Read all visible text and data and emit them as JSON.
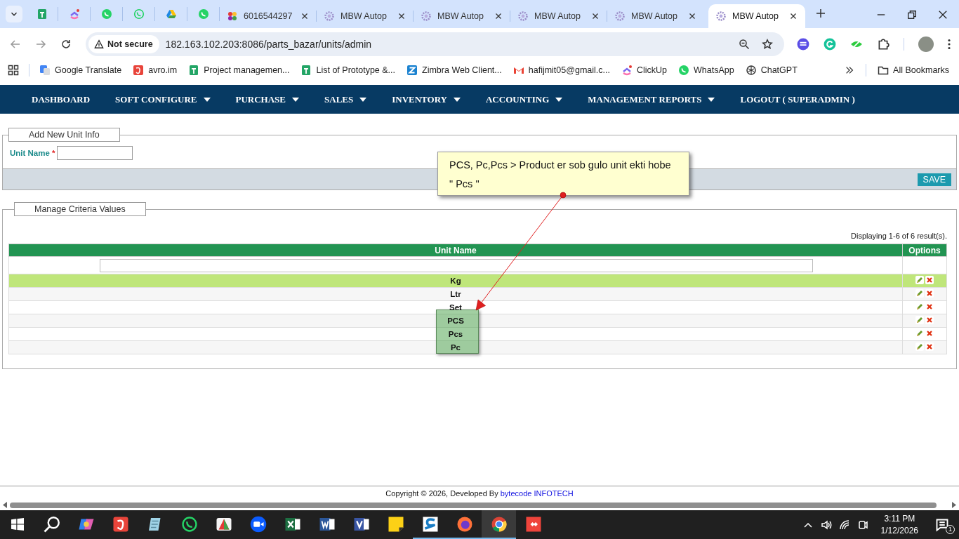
{
  "browser": {
    "tabs": [
      {
        "kind": "sheet",
        "selected": false
      },
      {
        "kind": "clickup",
        "selected": false
      },
      {
        "kind": "chat",
        "selected": false
      },
      {
        "kind": "chat-outline",
        "selected": false
      },
      {
        "kind": "drive",
        "selected": false
      },
      {
        "kind": "chat",
        "selected": false
      },
      {
        "kind": "pinwheel",
        "title": "6016544297",
        "selected": false
      },
      {
        "kind": "flower",
        "title": "MBW Autop",
        "selected": false
      },
      {
        "kind": "flower",
        "title": "MBW Autop",
        "selected": false
      },
      {
        "kind": "flower",
        "title": "MBW Autop",
        "selected": false
      },
      {
        "kind": "flower",
        "title": "MBW Autop",
        "selected": false
      },
      {
        "kind": "flower",
        "title": "MBW Autop",
        "selected": true
      }
    ],
    "security_label": "Not secure",
    "url": "182.163.102.203:8086/parts_bazar/units/admin",
    "bookmarks": [
      {
        "kind": "translate",
        "label": "Google Translate"
      },
      {
        "kind": "avro",
        "label": "avro.im"
      },
      {
        "kind": "sheet",
        "label": "Project managemen..."
      },
      {
        "kind": "sheet",
        "label": "List of Prototype &..."
      },
      {
        "kind": "zimbra",
        "label": "Zimbra Web Client..."
      },
      {
        "kind": "mail",
        "label": "hafijmit05@gmail.c..."
      },
      {
        "kind": "clickup",
        "label": "ClickUp"
      },
      {
        "kind": "chat",
        "label": "WhatsApp"
      },
      {
        "kind": "knot",
        "label": "ChatGPT"
      }
    ],
    "all_bookmarks": "All Bookmarks"
  },
  "nav": [
    {
      "label": "DASHBOARD",
      "has_menu": false
    },
    {
      "label": "SOFT CONFIGURE",
      "has_menu": true
    },
    {
      "label": "PURCHASE",
      "has_menu": true
    },
    {
      "label": "SALES",
      "has_menu": true
    },
    {
      "label": "INVENTORY",
      "has_menu": true
    },
    {
      "label": "ACCOUNTING",
      "has_menu": true
    },
    {
      "label": "MANAGEMENT REPORTS",
      "has_menu": true
    },
    {
      "label": "LOGOUT ( SUPERADMIN )",
      "has_menu": false
    }
  ],
  "unit_form": {
    "legend": "Add New Unit Info",
    "field_label": "Unit Name",
    "required_mark": "*",
    "save_button": "SAVE"
  },
  "criteria": {
    "legend": "Manage Criteria Values",
    "summary": "Displaying 1-6 of 6 result(s).",
    "columns": [
      "Unit Name",
      "Options"
    ],
    "rows": [
      {
        "name": "Kg",
        "selected": true
      },
      {
        "name": "Ltr",
        "selected": false
      },
      {
        "name": "Set",
        "selected": false
      },
      {
        "name": "PCS",
        "selected": false
      },
      {
        "name": "Pcs",
        "selected": false
      },
      {
        "name": "Pc",
        "selected": false
      }
    ]
  },
  "annotation": {
    "lines": [
      "PCS, Pc,Pcs > Product er sob gulo unit ekti hobe",
      "\" Pcs \""
    ]
  },
  "footer": {
    "text": "Copyright © 2026, Developed By",
    "link": "bytecode INFOTECH"
  },
  "taskbar": {
    "apps": [
      {
        "kind": "search",
        "running": false,
        "selected": false
      },
      {
        "kind": "copilot",
        "running": false,
        "selected": false
      },
      {
        "kind": "avro",
        "running": false,
        "selected": false
      },
      {
        "kind": "notepad",
        "running": false,
        "selected": false
      },
      {
        "kind": "chat-outline",
        "running": false,
        "selected": false
      },
      {
        "kind": "triangle",
        "running": false,
        "selected": false
      },
      {
        "kind": "camera",
        "running": false,
        "selected": false
      },
      {
        "kind": "excel",
        "running": false,
        "selected": false
      },
      {
        "kind": "word",
        "running": false,
        "selected": false
      },
      {
        "kind": "visio",
        "running": false,
        "selected": false
      },
      {
        "kind": "sticky",
        "running": false,
        "selected": false
      },
      {
        "kind": "s-app",
        "running": true,
        "selected": false
      },
      {
        "kind": "fox",
        "running": true,
        "selected": false
      },
      {
        "kind": "browser",
        "running": true,
        "selected": true
      },
      {
        "kind": "remote",
        "running": false,
        "selected": false
      }
    ],
    "time": "3:11 PM",
    "date": "1/12/2026",
    "notifications": "1"
  }
}
